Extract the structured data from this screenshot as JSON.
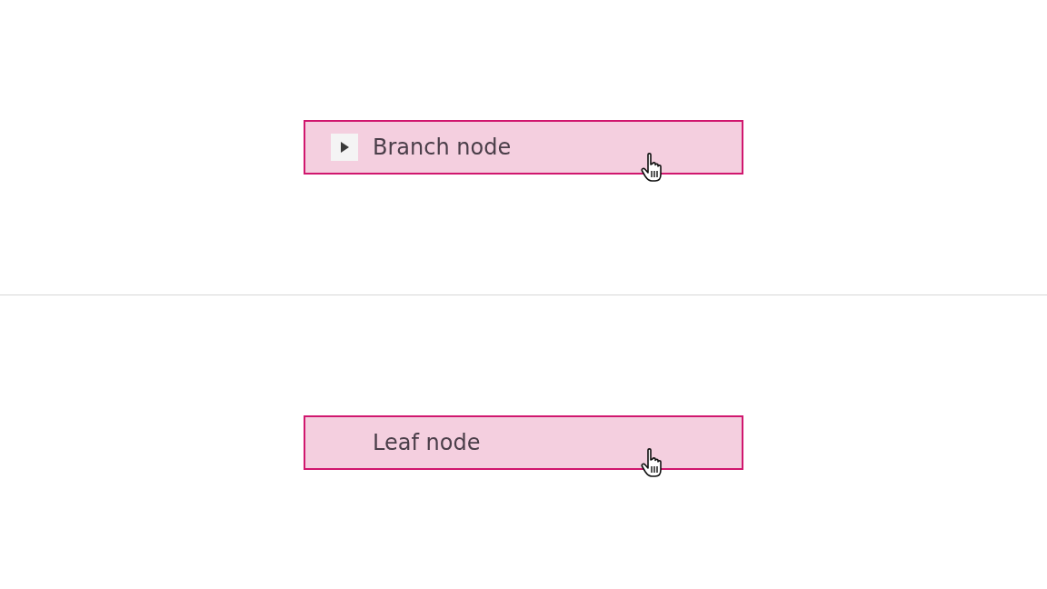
{
  "nodes": [
    {
      "kind": "branch",
      "label": "Branch node",
      "expanded": false,
      "hovered": true
    },
    {
      "kind": "leaf",
      "label": "Leaf node",
      "hovered": true
    }
  ]
}
